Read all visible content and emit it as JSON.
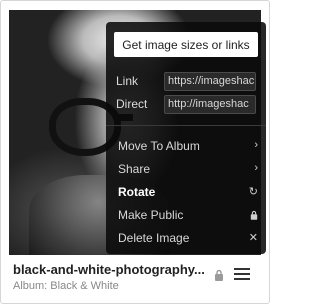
{
  "card": {
    "title": "black-and-white-photography...",
    "album": "Album: Black & White"
  },
  "menu": {
    "primary_button": "Get image sizes or links",
    "links": [
      {
        "label": "Link",
        "value": "https://imageshac"
      },
      {
        "label": "Direct",
        "value": "http://imageshac"
      }
    ],
    "items": [
      {
        "label": "Move To Album",
        "icon": "chevron-right-icon",
        "glyph": "›"
      },
      {
        "label": "Share",
        "icon": "chevron-right-icon",
        "glyph": "›"
      },
      {
        "label": "Rotate",
        "icon": "rotate-icon",
        "glyph": "↻"
      },
      {
        "label": "Make Public",
        "icon": "lock-icon",
        "glyph": "🔒"
      },
      {
        "label": "Delete Image",
        "icon": "close-icon",
        "glyph": "✕"
      }
    ]
  },
  "colors": {
    "menu_bg": "#0a0a0a",
    "accent_white": "#ffffff"
  }
}
